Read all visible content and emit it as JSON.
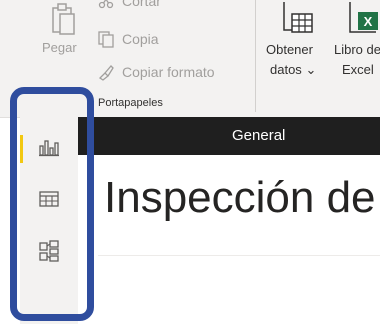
{
  "ribbon": {
    "paste_label": "Pegar",
    "cut_label": "Cortar",
    "copy_label": "Copia",
    "format_painter_label": "Copiar formato",
    "clipboard_group_label": "Portapapeles",
    "get_data_line1": "Obtener",
    "get_data_line2": "datos",
    "get_data_chevron": "⌄",
    "excel_line1": "Libro de",
    "excel_line2": "Excel"
  },
  "left_rail": {
    "active_view": "report",
    "icons": [
      "bar-chart-icon",
      "table-grid-icon",
      "model-icon"
    ]
  },
  "tab": {
    "label": "General"
  },
  "main": {
    "title": "Inspección de"
  },
  "colors": {
    "ribbon_bg": "#f3f2f1",
    "tab_bar_bg": "#1f1f1f",
    "active_indicator": "#f2c811",
    "highlight_border": "#2f4d9e",
    "excel_green": "#217346",
    "disabled_text": "#a19f9d"
  }
}
